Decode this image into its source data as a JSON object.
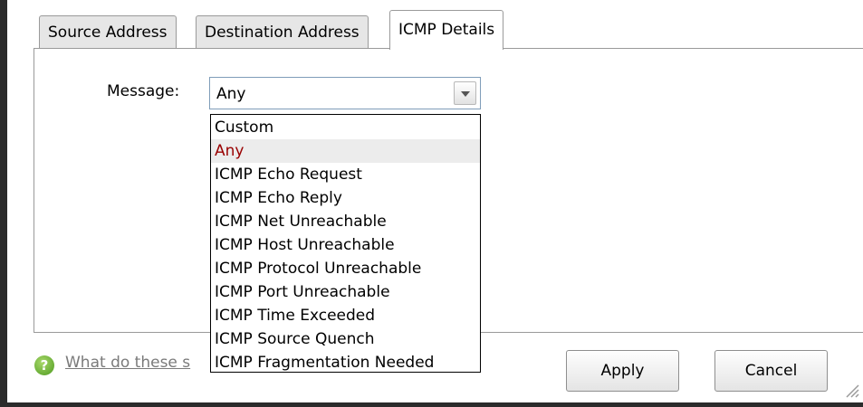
{
  "tabs": [
    {
      "label": "Source Address"
    },
    {
      "label": "Destination Address"
    },
    {
      "label": "ICMP Details"
    }
  ],
  "active_tab": "ICMP Details",
  "message_field": {
    "label": "Message:",
    "value": "Any"
  },
  "dropdown": {
    "options": [
      "Custom",
      "Any",
      "ICMP Echo Request",
      "ICMP Echo Reply",
      "ICMP Net Unreachable",
      "ICMP Host Unreachable",
      "ICMP Protocol Unreachable",
      "ICMP Port Unreachable",
      "ICMP Time Exceeded",
      "ICMP Source Quench",
      "ICMP Fragmentation Needed"
    ],
    "selected": "Any"
  },
  "help": {
    "icon": "question-help-icon",
    "link_text": "What do these s"
  },
  "buttons": {
    "apply": "Apply",
    "cancel": "Cancel"
  },
  "colors": {
    "selected_text": "#990000",
    "selected_bg": "#ececec",
    "help_icon": "#4d9a1f",
    "link": "#7a7a7a"
  }
}
